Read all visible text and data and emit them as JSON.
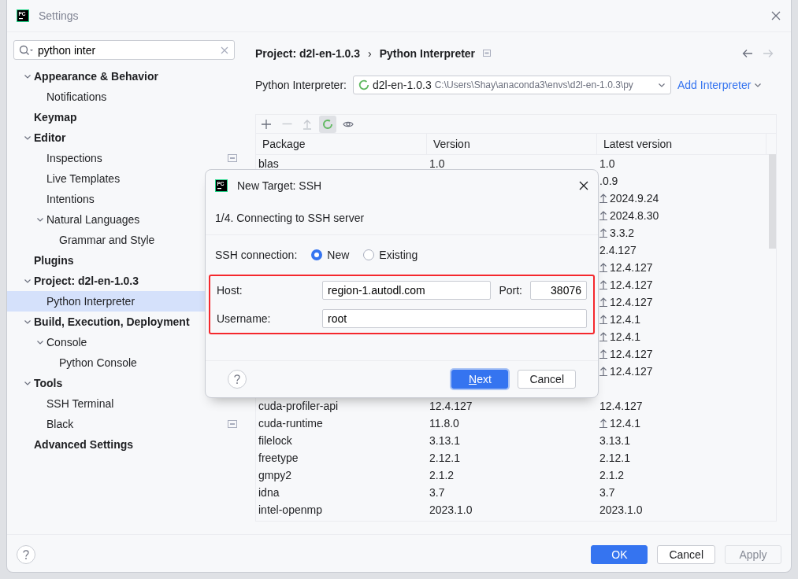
{
  "window": {
    "title": "Settings",
    "logo": "PC"
  },
  "search": {
    "value": "python inter"
  },
  "sidebar": {
    "items": [
      {
        "label": "Appearance & Behavior",
        "selected": false,
        "expanded": true,
        "project_level": false,
        "children": [
          {
            "label": "Notifications",
            "selected": false,
            "project_level": false
          }
        ]
      },
      {
        "label": "Keymap",
        "selected": false,
        "project_level": false
      },
      {
        "label": "Editor",
        "selected": false,
        "expanded": true,
        "project_level": false,
        "children": [
          {
            "label": "Inspections",
            "selected": false,
            "project_level": true
          },
          {
            "label": "Live Templates",
            "selected": false,
            "project_level": false
          },
          {
            "label": "Intentions",
            "selected": false,
            "project_level": false
          },
          {
            "label": "Natural Languages",
            "selected": false,
            "expanded": true,
            "project_level": false,
            "children": [
              {
                "label": "Grammar and Style",
                "selected": false,
                "project_level": false
              }
            ]
          }
        ]
      },
      {
        "label": "Plugins",
        "selected": false,
        "project_level": false
      },
      {
        "label": "Project: d2l-en-1.0.3",
        "selected": false,
        "expanded": true,
        "project_level": false,
        "children": [
          {
            "label": "Python Interpreter",
            "selected": true,
            "project_level": false
          }
        ]
      },
      {
        "label": "Build, Execution, Deployment",
        "selected": false,
        "expanded": true,
        "project_level": false,
        "children": [
          {
            "label": "Console",
            "selected": false,
            "expanded": true,
            "project_level": false,
            "children": [
              {
                "label": "Python Console",
                "selected": false,
                "project_level": false
              }
            ]
          }
        ]
      },
      {
        "label": "Tools",
        "selected": false,
        "expanded": true,
        "project_level": false,
        "children": [
          {
            "label": "SSH Terminal",
            "selected": false,
            "project_level": false
          },
          {
            "label": "Black",
            "selected": false,
            "project_level": true
          }
        ]
      },
      {
        "label": "Advanced Settings",
        "selected": false,
        "project_level": false
      }
    ]
  },
  "breadcrumb": {
    "items": [
      "Project: d2l-en-1.0.3",
      "Python Interpreter"
    ],
    "separator": "›"
  },
  "interpreter": {
    "label": "Python Interpreter:",
    "name": "d2l-en-1.0.3",
    "path": "C:\\Users\\Shay\\anaconda3\\envs\\d2l-en-1.0.3\\py",
    "add_label": "Add Interpreter"
  },
  "toolbar": [
    {
      "kind": "add",
      "disabled": false,
      "pressed": false
    },
    {
      "kind": "remove",
      "disabled": true,
      "pressed": false
    },
    {
      "kind": "upgrade",
      "disabled": true,
      "pressed": false
    },
    {
      "kind": "refresh",
      "disabled": false,
      "pressed": true
    },
    {
      "kind": "show",
      "disabled": false,
      "pressed": false
    }
  ],
  "table": {
    "columns": [
      "Package",
      "Version",
      "Latest version"
    ],
    "rows": [
      {
        "package": "blas",
        "version": "1.0",
        "latest": "1.0",
        "upgrade": false
      },
      {
        "latest": ".0.9",
        "upgrade": false
      },
      {
        "latest": "2024.9.24",
        "upgrade": true
      },
      {
        "latest": "2024.8.30",
        "upgrade": true
      },
      {
        "latest": "3.3.2",
        "upgrade": true
      },
      {
        "latest": "2.4.127",
        "upgrade": false
      },
      {
        "latest": "12.4.127",
        "upgrade": true
      },
      {
        "latest": "12.4.127",
        "upgrade": true
      },
      {
        "latest": "12.4.127",
        "upgrade": true
      },
      {
        "latest": "12.4.1",
        "upgrade": true
      },
      {
        "latest": "12.4.1",
        "upgrade": true
      },
      {
        "latest": "12.4.127",
        "upgrade": true
      },
      {
        "latest": "12.4.127",
        "upgrade": true
      },
      {},
      {
        "package": "cuda-profiler-api",
        "version": "12.4.127",
        "latest": "12.4.127",
        "upgrade": false
      },
      {
        "package": "cuda-runtime",
        "version": "11.8.0",
        "latest": "12.4.1",
        "upgrade": true
      },
      {
        "package": "filelock",
        "version": "3.13.1",
        "latest": "3.13.1",
        "upgrade": false
      },
      {
        "package": "freetype",
        "version": "2.12.1",
        "latest": "2.12.1",
        "upgrade": false
      },
      {
        "package": "gmpy2",
        "version": "2.1.2",
        "latest": "2.1.2",
        "upgrade": false
      },
      {
        "package": "idna",
        "version": "3.7",
        "latest": "3.7",
        "upgrade": false
      },
      {
        "package": "intel-openmp",
        "version": "2023.1.0",
        "latest": "2023.1.0",
        "upgrade": false
      }
    ]
  },
  "buttons": [
    {
      "label": "OK",
      "kind": "primary",
      "disabled": false
    },
    {
      "label": "Cancel",
      "kind": "normal",
      "disabled": false
    },
    {
      "label": "Apply",
      "kind": "normal",
      "disabled": true
    }
  ],
  "dialog": {
    "title": "New Target: SSH",
    "logo": "PC",
    "step": "1/4. Connecting to SSH server",
    "connection": {
      "label": "SSH connection:",
      "options": [
        {
          "label": "New",
          "selected": true
        },
        {
          "label": "Existing",
          "selected": false
        }
      ]
    },
    "highlighted": true,
    "host": {
      "label": "Host:",
      "value": "region-1.autodl.com"
    },
    "port": {
      "label": "Port:",
      "value": "38076"
    },
    "username": {
      "label": "Username:",
      "value": "root"
    },
    "buttons": [
      {
        "label": "Next",
        "default": true,
        "mnemonic": true
      },
      {
        "label": "Cancel",
        "default": false,
        "mnemonic": false
      }
    ]
  }
}
